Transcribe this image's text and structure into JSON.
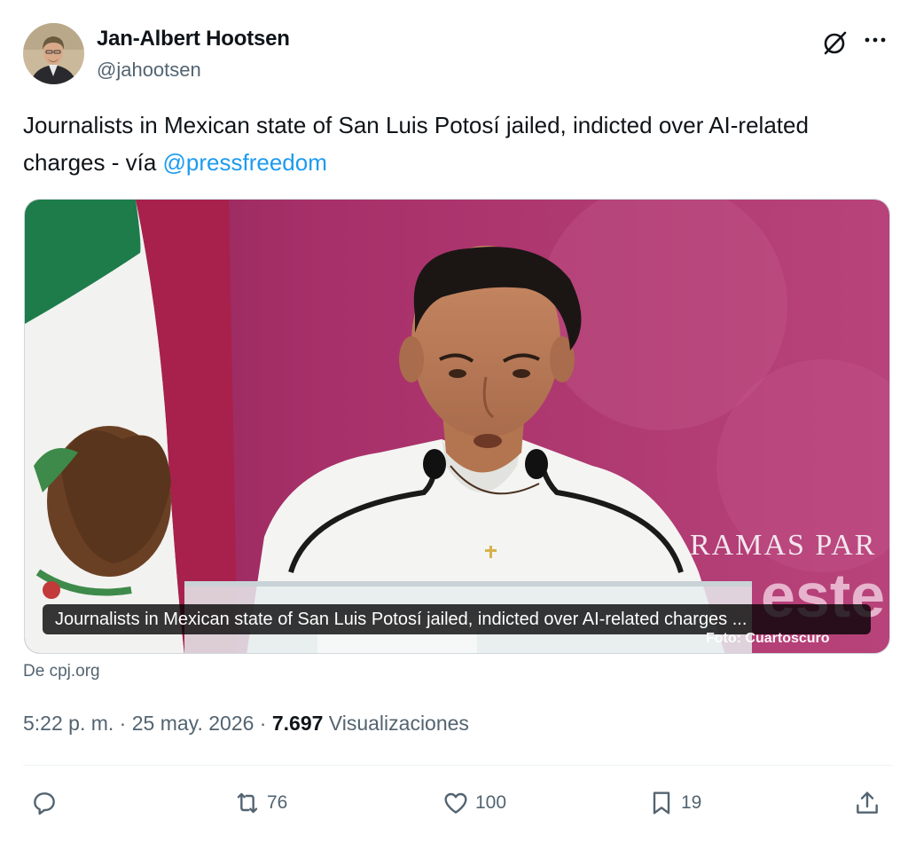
{
  "user": {
    "name": "Jan-Albert Hootsen",
    "handle": "@jahootsen"
  },
  "tweet": {
    "text_before": "Journalists in Mexican state of San Luis Potosí jailed, indicted over AI-related charges - vía ",
    "mention": "@pressfreedom"
  },
  "media": {
    "caption": "Journalists in Mexican state of San Luis Potosí jailed, indicted over AI-related charges ...",
    "photo_credit": "Foto: Cuartoscuro",
    "backdrop_text_1": "RAMAS PAR",
    "backdrop_text_2": "este"
  },
  "source": "De cpj.org",
  "meta": {
    "time": "5:22 p. m.",
    "sep1": " · ",
    "date": "25 may. 2026",
    "sep2": " · ",
    "views_count": "7.697",
    "views_label": " Visualizaciones"
  },
  "actions": {
    "reply_count": "",
    "retweet_count": "76",
    "like_count": "100",
    "bookmark_count": "19"
  },
  "colors": {
    "accent": "#1d9bf0",
    "secondary_text": "#536471"
  }
}
